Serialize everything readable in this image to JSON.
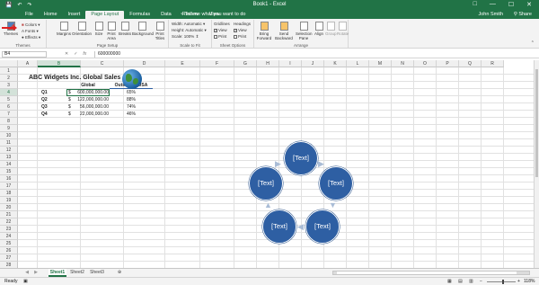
{
  "window": {
    "title": "Book1 - Excel",
    "minimize": "—",
    "restore": "☐",
    "close": "✕",
    "restore_ribbon": "□"
  },
  "qat": {
    "save": "💾",
    "undo": "↶",
    "redo": "↷"
  },
  "tabs": [
    "File",
    "Home",
    "Insert",
    "Page Layout",
    "Formulas",
    "Data",
    "Review",
    "View"
  ],
  "tell_me": "Tell me what you want to do",
  "user": "John Smith",
  "share": "Share",
  "ribbon": {
    "themes": {
      "label": "Themes",
      "colors": "Colors",
      "fonts": "Fonts",
      "effects": "Effects",
      "group": "Themes"
    },
    "page_setup": {
      "buttons": [
        "Margins",
        "Orientation",
        "Size",
        "Print Area",
        "Breaks",
        "Background",
        "Print Titles"
      ],
      "group": "Page Setup"
    },
    "scale": {
      "width_label": "Width:",
      "width_val": "Automatic",
      "height_label": "Height:",
      "height_val": "Automatic",
      "scale_label": "Scale:",
      "scale_val": "100%",
      "group": "Scale to Fit"
    },
    "sheet_options": {
      "gridlines": "Gridlines",
      "headings": "Headings",
      "view": "View",
      "print": "Print",
      "group": "Sheet Options"
    },
    "arrange": {
      "buttons": [
        "Bring Forward",
        "Send Backward",
        "Selection Pane",
        "Align",
        "Group",
        "Rotate"
      ],
      "group": "Arrange"
    }
  },
  "formula": {
    "namebox": "B4",
    "cancel": "✕",
    "enter": "✓",
    "fx": "fx",
    "value": "600000000"
  },
  "columns": [
    "A",
    "B",
    "C",
    "D",
    "E",
    "F",
    "G",
    "H",
    "I",
    "J",
    "K",
    "L",
    "M",
    "N",
    "O",
    "P",
    "Q",
    "R"
  ],
  "rows": [
    "1",
    "2",
    "3",
    "4",
    "5",
    "6",
    "7",
    "8",
    "9",
    "10",
    "11",
    "12",
    "13",
    "14",
    "15",
    "16",
    "17",
    "18",
    "19",
    "20",
    "21",
    "22",
    "23",
    "24",
    "25",
    "26",
    "27",
    "28"
  ],
  "sheet": {
    "title": "ABC Widgets Inc. Global Sales",
    "header_global": "Global",
    "header_outside": "Outside of USA",
    "data": [
      {
        "q": "Q1",
        "dollar": "$",
        "global": "600,000,000.00",
        "pct": "65%"
      },
      {
        "q": "Q2",
        "dollar": "$",
        "global": "122,000,000.00",
        "pct": "88%"
      },
      {
        "q": "Q3",
        "dollar": "$",
        "global": "56,000,000.00",
        "pct": "74%"
      },
      {
        "q": "Q4",
        "dollar": "$",
        "global": "22,000,000.00",
        "pct": "46%"
      }
    ]
  },
  "smartart": {
    "nodes": [
      "[Text]",
      "[Text]",
      "[Text]",
      "[Text]",
      "[Text]"
    ],
    "fill": "#2e5fa3"
  },
  "sheets": [
    "Sheet1",
    "Sheet2",
    "Sheet3"
  ],
  "add_sheet": "⊕",
  "status": {
    "mode": "Ready",
    "zoom_out": "−",
    "zoom_in": "+",
    "zoom": "118%"
  },
  "colors": {
    "accent": "#217346",
    "selection_fill": "#d3e2d9"
  }
}
